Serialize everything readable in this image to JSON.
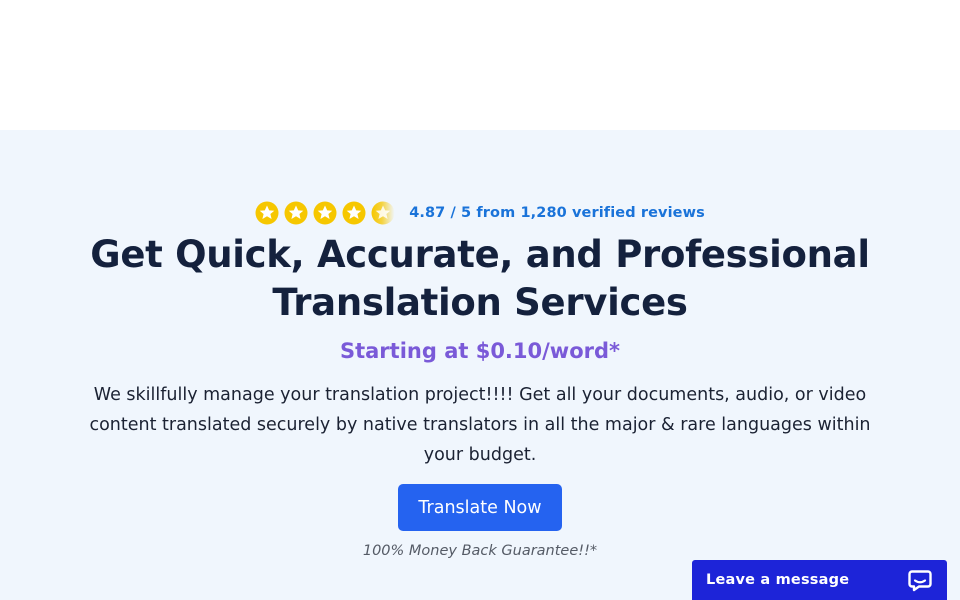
{
  "rating": {
    "stars_value": 4.87,
    "stars_max": 5,
    "text": "4.87 / 5 from 1,280 verified reviews",
    "star_color": "#f6c700"
  },
  "hero": {
    "headline": "Get Quick, Accurate, and Professional Translation Services",
    "price": "Starting at $0.10/word*",
    "description": "We skillfully manage your translation project!!!! Get all your documents, audio, or video content translated securely by native translators in all the major & rare languages within your budget.",
    "cta_label": "Translate Now",
    "guarantee": "100% Money Back Guarantee!!*"
  },
  "chat": {
    "label": "Leave a message",
    "icon": "chat-bubble-icon"
  },
  "colors": {
    "hero_bg": "#f0f6fd",
    "headline": "#14213d",
    "accent_purple": "#7a5ad8",
    "link_blue": "#1a73d9",
    "button_blue": "#2563f0",
    "chat_blue": "#1d24d8"
  }
}
